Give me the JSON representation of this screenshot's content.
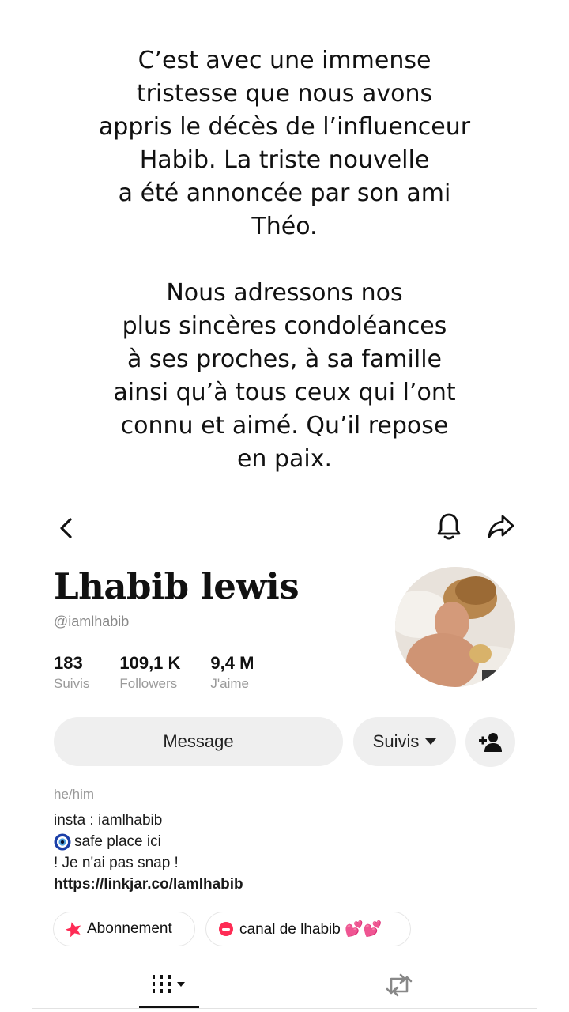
{
  "caption": {
    "paragraph1": "C’est avec une immense\ntristesse que nous avons\nappris le décès de l’influenceur\nHabib. La triste nouvelle\na été annoncée par son ami\nThéo.",
    "paragraph2": "Nous adressons nos\nplus sincères condoléances\nà ses proches, à sa famille\nainsi qu’à tous ceux qui l’ont\nconnu et aimé. Qu’il repose\nen paix."
  },
  "header": {
    "icons": [
      "chevron-left-icon",
      "bell-icon",
      "share-icon"
    ]
  },
  "profile": {
    "name": "Lhabib lewis",
    "handle": "@iamlhabib",
    "stats": [
      {
        "value": "183",
        "label": "Suivis"
      },
      {
        "value": "109,1 K",
        "label": "Followers"
      },
      {
        "value": "9,4 M",
        "label": "J'aime"
      }
    ],
    "pronouns": "he/him",
    "bio": {
      "line1": "insta : iamlhabib",
      "line2": "safe place ici",
      "line3": "! Je n'ai pas snap !",
      "link": "https://linkjar.co/Iamlhabib"
    }
  },
  "actions": {
    "message_label": "Message",
    "follow_label": "Suivis",
    "add_friend_icon": "add-user-icon"
  },
  "chips": [
    {
      "label": "Abonnement",
      "icon": "star-pink-icon"
    },
    {
      "label": "canal de lhabib 💕💕",
      "icon": "chat-bubble-icon"
    }
  ],
  "tabs": [
    {
      "icon": "videos-grid-icon",
      "active": true
    },
    {
      "icon": "repost-icon",
      "active": false
    }
  ],
  "colors": {
    "text": "#111111",
    "muted": "#8a8a8a",
    "button_bg": "#efefef",
    "accent_pink": "#fe2c55"
  }
}
